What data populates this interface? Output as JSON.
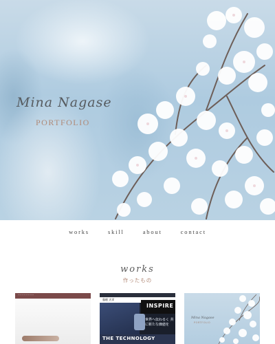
{
  "hero": {
    "title": "Mina Nagase",
    "subtitle": "PORTFOLIO"
  },
  "nav": {
    "items": [
      "works",
      "skill",
      "about",
      "contact"
    ]
  },
  "works": {
    "title": "works",
    "subtitle": "作ったもの",
    "cards": [
      {
        "header": "~~~~~~~~"
      },
      {
        "header": "島根 大学",
        "badge": "INSPIRE",
        "caption": "世界へ伝わるく 共に新たな価値を",
        "footer": "THE TECHNOLOGY"
      },
      {
        "title": "Mina Nagase",
        "subtitle": "PORTFOLIO"
      }
    ]
  },
  "colors": {
    "accent": "#b08a78",
    "hero_sky": "#b9d2e3",
    "card1_bar": "#7b4a4a",
    "card2_bg": "#1a1f2b"
  }
}
